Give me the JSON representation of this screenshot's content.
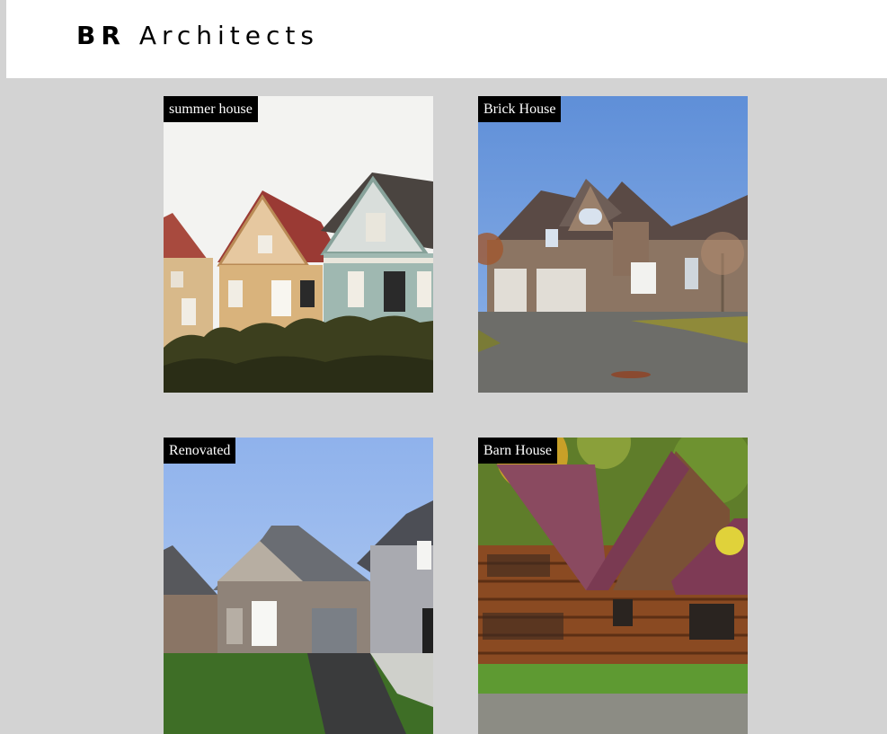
{
  "header": {
    "logo_bold": "BR",
    "logo_rest": "Architects"
  },
  "gallery": {
    "items": [
      {
        "caption": "summer house"
      },
      {
        "caption": "Brick House"
      },
      {
        "caption": "Renovated"
      },
      {
        "caption": "Barn House"
      }
    ]
  },
  "colors": {
    "background": "#d3d3d3",
    "header_bg": "#ffffff",
    "caption_bg": "#000000",
    "caption_text": "#ffffff"
  }
}
